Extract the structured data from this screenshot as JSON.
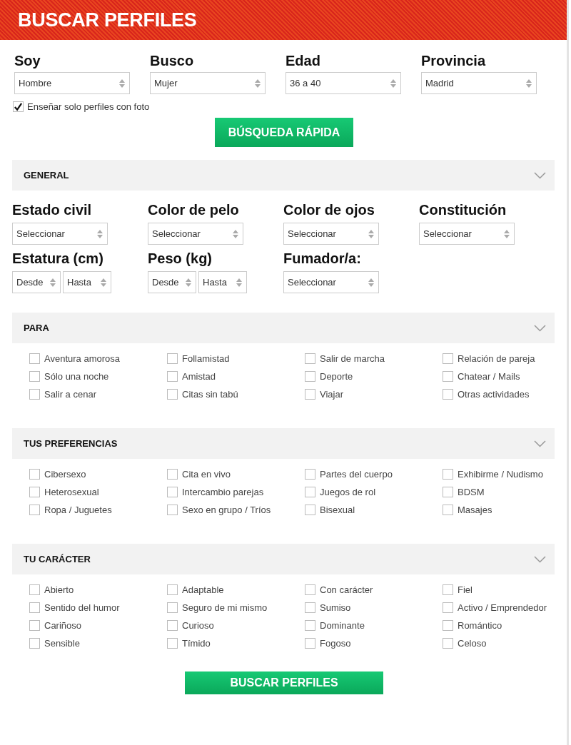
{
  "header": {
    "title": "BUSCAR PERFILES"
  },
  "filters": [
    {
      "label": "Soy",
      "value": "Hombre"
    },
    {
      "label": "Busco",
      "value": "Mujer"
    },
    {
      "label": "Edad",
      "value": "36 a 40"
    },
    {
      "label": "Provincia",
      "value": "Madrid"
    }
  ],
  "photo_only": {
    "label": "Enseñar solo perfiles con foto",
    "checked": true
  },
  "quick_button": "BÚSQUEDA RÁPIDA",
  "sections": [
    {
      "title": "GENERAL",
      "kind": "fields",
      "fields": [
        {
          "label": "Estado civil",
          "selects": [
            "Seleccionar"
          ]
        },
        {
          "label": "Color de pelo",
          "selects": [
            "Seleccionar"
          ]
        },
        {
          "label": "Color de ojos",
          "selects": [
            "Seleccionar"
          ]
        },
        {
          "label": "Constitución",
          "selects": [
            "Seleccionar"
          ]
        },
        {
          "label": "Estatura (cm)",
          "selects": [
            "Desde",
            "Hasta"
          ]
        },
        {
          "label": "Peso (kg)",
          "selects": [
            "Desde",
            "Hasta"
          ]
        },
        {
          "label": "Fumador/a:",
          "selects": [
            "Seleccionar"
          ]
        }
      ]
    },
    {
      "title": "PARA",
      "kind": "checks",
      "options": [
        {
          "label": "Aventura amorosa",
          "checked": false
        },
        {
          "label": "Follamistad",
          "checked": false
        },
        {
          "label": "Salir de marcha",
          "checked": false
        },
        {
          "label": "Relación de pareja",
          "checked": false
        },
        {
          "label": "Sólo una noche",
          "checked": false
        },
        {
          "label": "Amistad",
          "checked": false
        },
        {
          "label": "Deporte",
          "checked": false
        },
        {
          "label": "Chatear / Mails",
          "checked": false
        },
        {
          "label": "Salir a cenar",
          "checked": false
        },
        {
          "label": "Citas sin tabú",
          "checked": false
        },
        {
          "label": "Viajar",
          "checked": false
        },
        {
          "label": "Otras actividades",
          "checked": false
        }
      ]
    },
    {
      "title": "TUS PREFERENCIAS",
      "kind": "checks",
      "options": [
        {
          "label": "Cibersexo",
          "checked": false
        },
        {
          "label": "Cita en vivo",
          "checked": false
        },
        {
          "label": "Partes del cuerpo",
          "checked": false
        },
        {
          "label": "Exhibirme / Nudismo",
          "checked": false
        },
        {
          "label": "Heterosexual",
          "checked": false
        },
        {
          "label": "Intercambio parejas",
          "checked": false
        },
        {
          "label": "Juegos de rol",
          "checked": false
        },
        {
          "label": "BDSM",
          "checked": false
        },
        {
          "label": "Ropa / Juguetes",
          "checked": false
        },
        {
          "label": "Sexo en grupo / Tríos",
          "checked": false
        },
        {
          "label": "Bisexual",
          "checked": false
        },
        {
          "label": "Masajes",
          "checked": false
        }
      ]
    },
    {
      "title": "TU CARÁCTER",
      "kind": "checks",
      "options": [
        {
          "label": "Abierto",
          "checked": false
        },
        {
          "label": "Adaptable",
          "checked": false
        },
        {
          "label": "Con carácter",
          "checked": false
        },
        {
          "label": "Fiel",
          "checked": false
        },
        {
          "label": "Sentido del humor",
          "checked": false
        },
        {
          "label": "Seguro de mi mismo",
          "checked": false
        },
        {
          "label": "Sumiso",
          "checked": false
        },
        {
          "label": "Activo / Emprendedor",
          "checked": false
        },
        {
          "label": "Cariñoso",
          "checked": false
        },
        {
          "label": "Curioso",
          "checked": false
        },
        {
          "label": "Dominante",
          "checked": false
        },
        {
          "label": "Romántico",
          "checked": false
        },
        {
          "label": "Sensible",
          "checked": false
        },
        {
          "label": "Tímido",
          "checked": false
        },
        {
          "label": "Fogoso",
          "checked": false
        },
        {
          "label": "Celoso",
          "checked": false
        }
      ]
    }
  ],
  "search_button": "BUSCAR PERFILES"
}
